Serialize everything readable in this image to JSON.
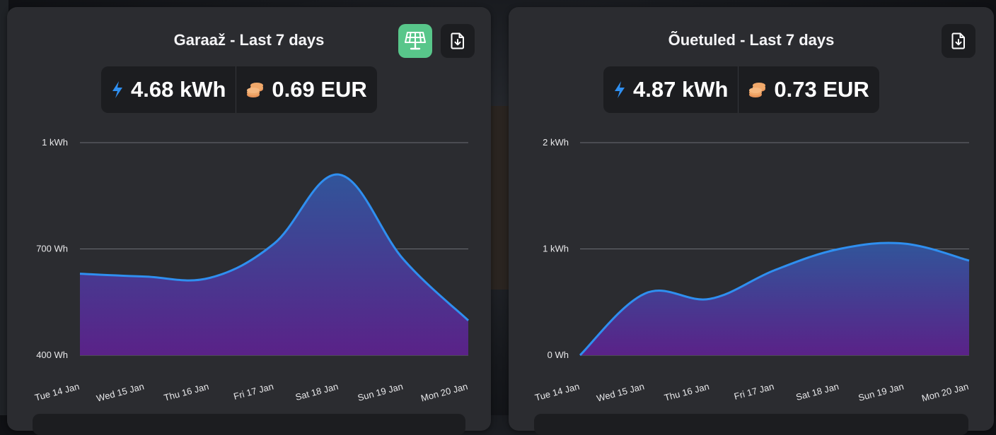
{
  "cards": [
    {
      "title": "Garaaž - Last 7 days",
      "energy": "4.68 kWh",
      "cost": "0.69 EUR",
      "buttons": [
        "solar-panel-icon",
        "download-file-icon"
      ]
    },
    {
      "title": "Õuetuled - Last 7 days",
      "energy": "4.87 kWh",
      "cost": "0.73 EUR",
      "buttons": [
        "download-file-icon"
      ]
    }
  ],
  "colors": {
    "line": "#2f8ff0",
    "fill_top": "#31559a",
    "fill_bottom": "#5a2288",
    "bolt": "#2f8ff0",
    "coins": "#f0a86a",
    "solar_button": "#58c68a"
  },
  "chart_data": [
    {
      "type": "area",
      "title": "Garaaž - Last 7 days",
      "unit": "Wh",
      "categories": [
        "Tue 14 Jan",
        "Wed 15 Jan",
        "Thu 16 Jan",
        "Fri 17 Jan",
        "Sat 18 Jan",
        "Sun 19 Jan",
        "Mon 20 Jan"
      ],
      "values": [
        630,
        622,
        618,
        715,
        910,
        670,
        498
      ],
      "ylim": [
        400,
        1000
      ],
      "yticks": [
        400,
        700,
        1000
      ],
      "ytick_labels": [
        "400 Wh",
        "700 Wh",
        "1 kWh"
      ],
      "grid": true
    },
    {
      "type": "area",
      "title": "Õuetuled - Last 7 days",
      "unit": "Wh",
      "categories": [
        "Tue 14 Jan",
        "Wed 15 Jan",
        "Thu 16 Jan",
        "Fri 17 Jan",
        "Sat 18 Jan",
        "Sun 19 Jan",
        "Mon 20 Jan"
      ],
      "values": [
        0,
        580,
        530,
        800,
        1000,
        1050,
        890
      ],
      "ylim": [
        0,
        2000
      ],
      "yticks": [
        0,
        1000,
        2000
      ],
      "ytick_labels": [
        "0 Wh",
        "1 kWh",
        "2 kWh"
      ],
      "grid": true
    }
  ]
}
